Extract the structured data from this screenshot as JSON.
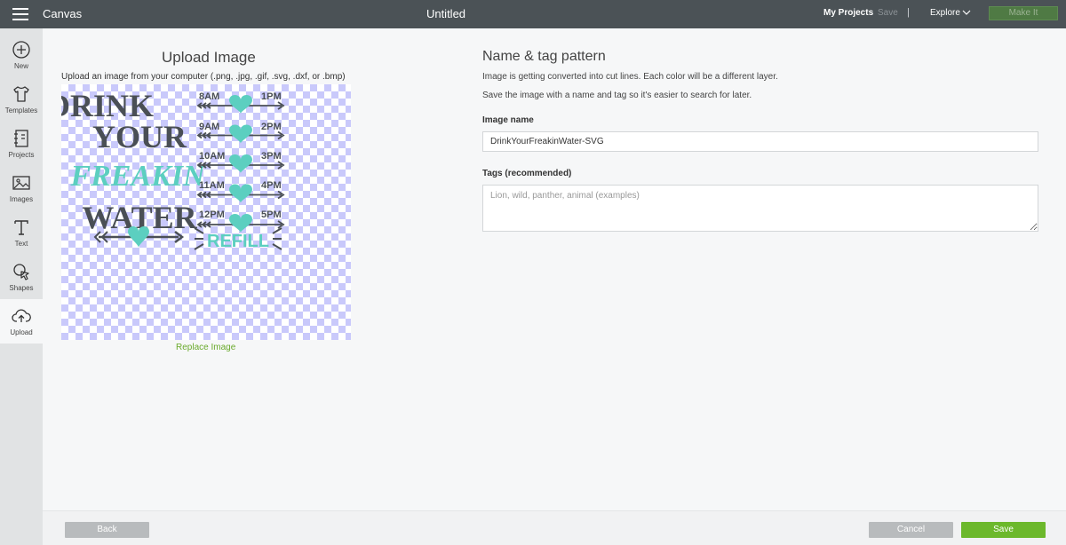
{
  "topbar": {
    "app_name": "Canvas",
    "doc_title": "Untitled",
    "my_projects": "My Projects",
    "save": "Save",
    "separator": "|",
    "explore": "Explore",
    "make_it": "Make It"
  },
  "sidebar": {
    "items": [
      {
        "label": "New",
        "icon": "plus-circle-icon"
      },
      {
        "label": "Templates",
        "icon": "tshirt-icon"
      },
      {
        "label": "Projects",
        "icon": "notebook-icon"
      },
      {
        "label": "Images",
        "icon": "image-icon"
      },
      {
        "label": "Text",
        "icon": "text-t-icon"
      },
      {
        "label": "Shapes",
        "icon": "shapes-icon"
      },
      {
        "label": "Upload",
        "icon": "cloud-upload-icon",
        "active": true
      }
    ]
  },
  "upload": {
    "title": "Upload Image",
    "subtitle": "Upload an image from your computer (.png, .jpg, .gif, .svg, .dxf, or .bmp)",
    "replace_link": "Replace Image",
    "design_text": {
      "line1": "DRINK",
      "line2": "YOUR",
      "line3": "FREAKIN",
      "line4": "WATER",
      "times": [
        [
          "8AM",
          "1PM"
        ],
        [
          "9AM",
          "2PM"
        ],
        [
          "10AM",
          "3PM"
        ],
        [
          "11AM",
          "4PM"
        ],
        [
          "12PM",
          "5PM"
        ]
      ],
      "refill": "REFILL"
    }
  },
  "form": {
    "title": "Name & tag pattern",
    "info1": "Image is getting converted into cut lines. Each color will be a different layer.",
    "info2": "Save the image with a name and tag so it's easier to search for later.",
    "name_label": "Image name",
    "name_value": "DrinkYourFreakinWater-SVG",
    "tags_label": "Tags (recommended)",
    "tags_placeholder": "Lion, wild, panther, animal (examples)"
  },
  "footer": {
    "back": "Back",
    "cancel": "Cancel",
    "save": "Save"
  },
  "colors": {
    "topbar": "#4b5256",
    "accent_green": "#6cb82c",
    "design_gray": "#4a4f55",
    "design_teal": "#5ccfc0"
  }
}
